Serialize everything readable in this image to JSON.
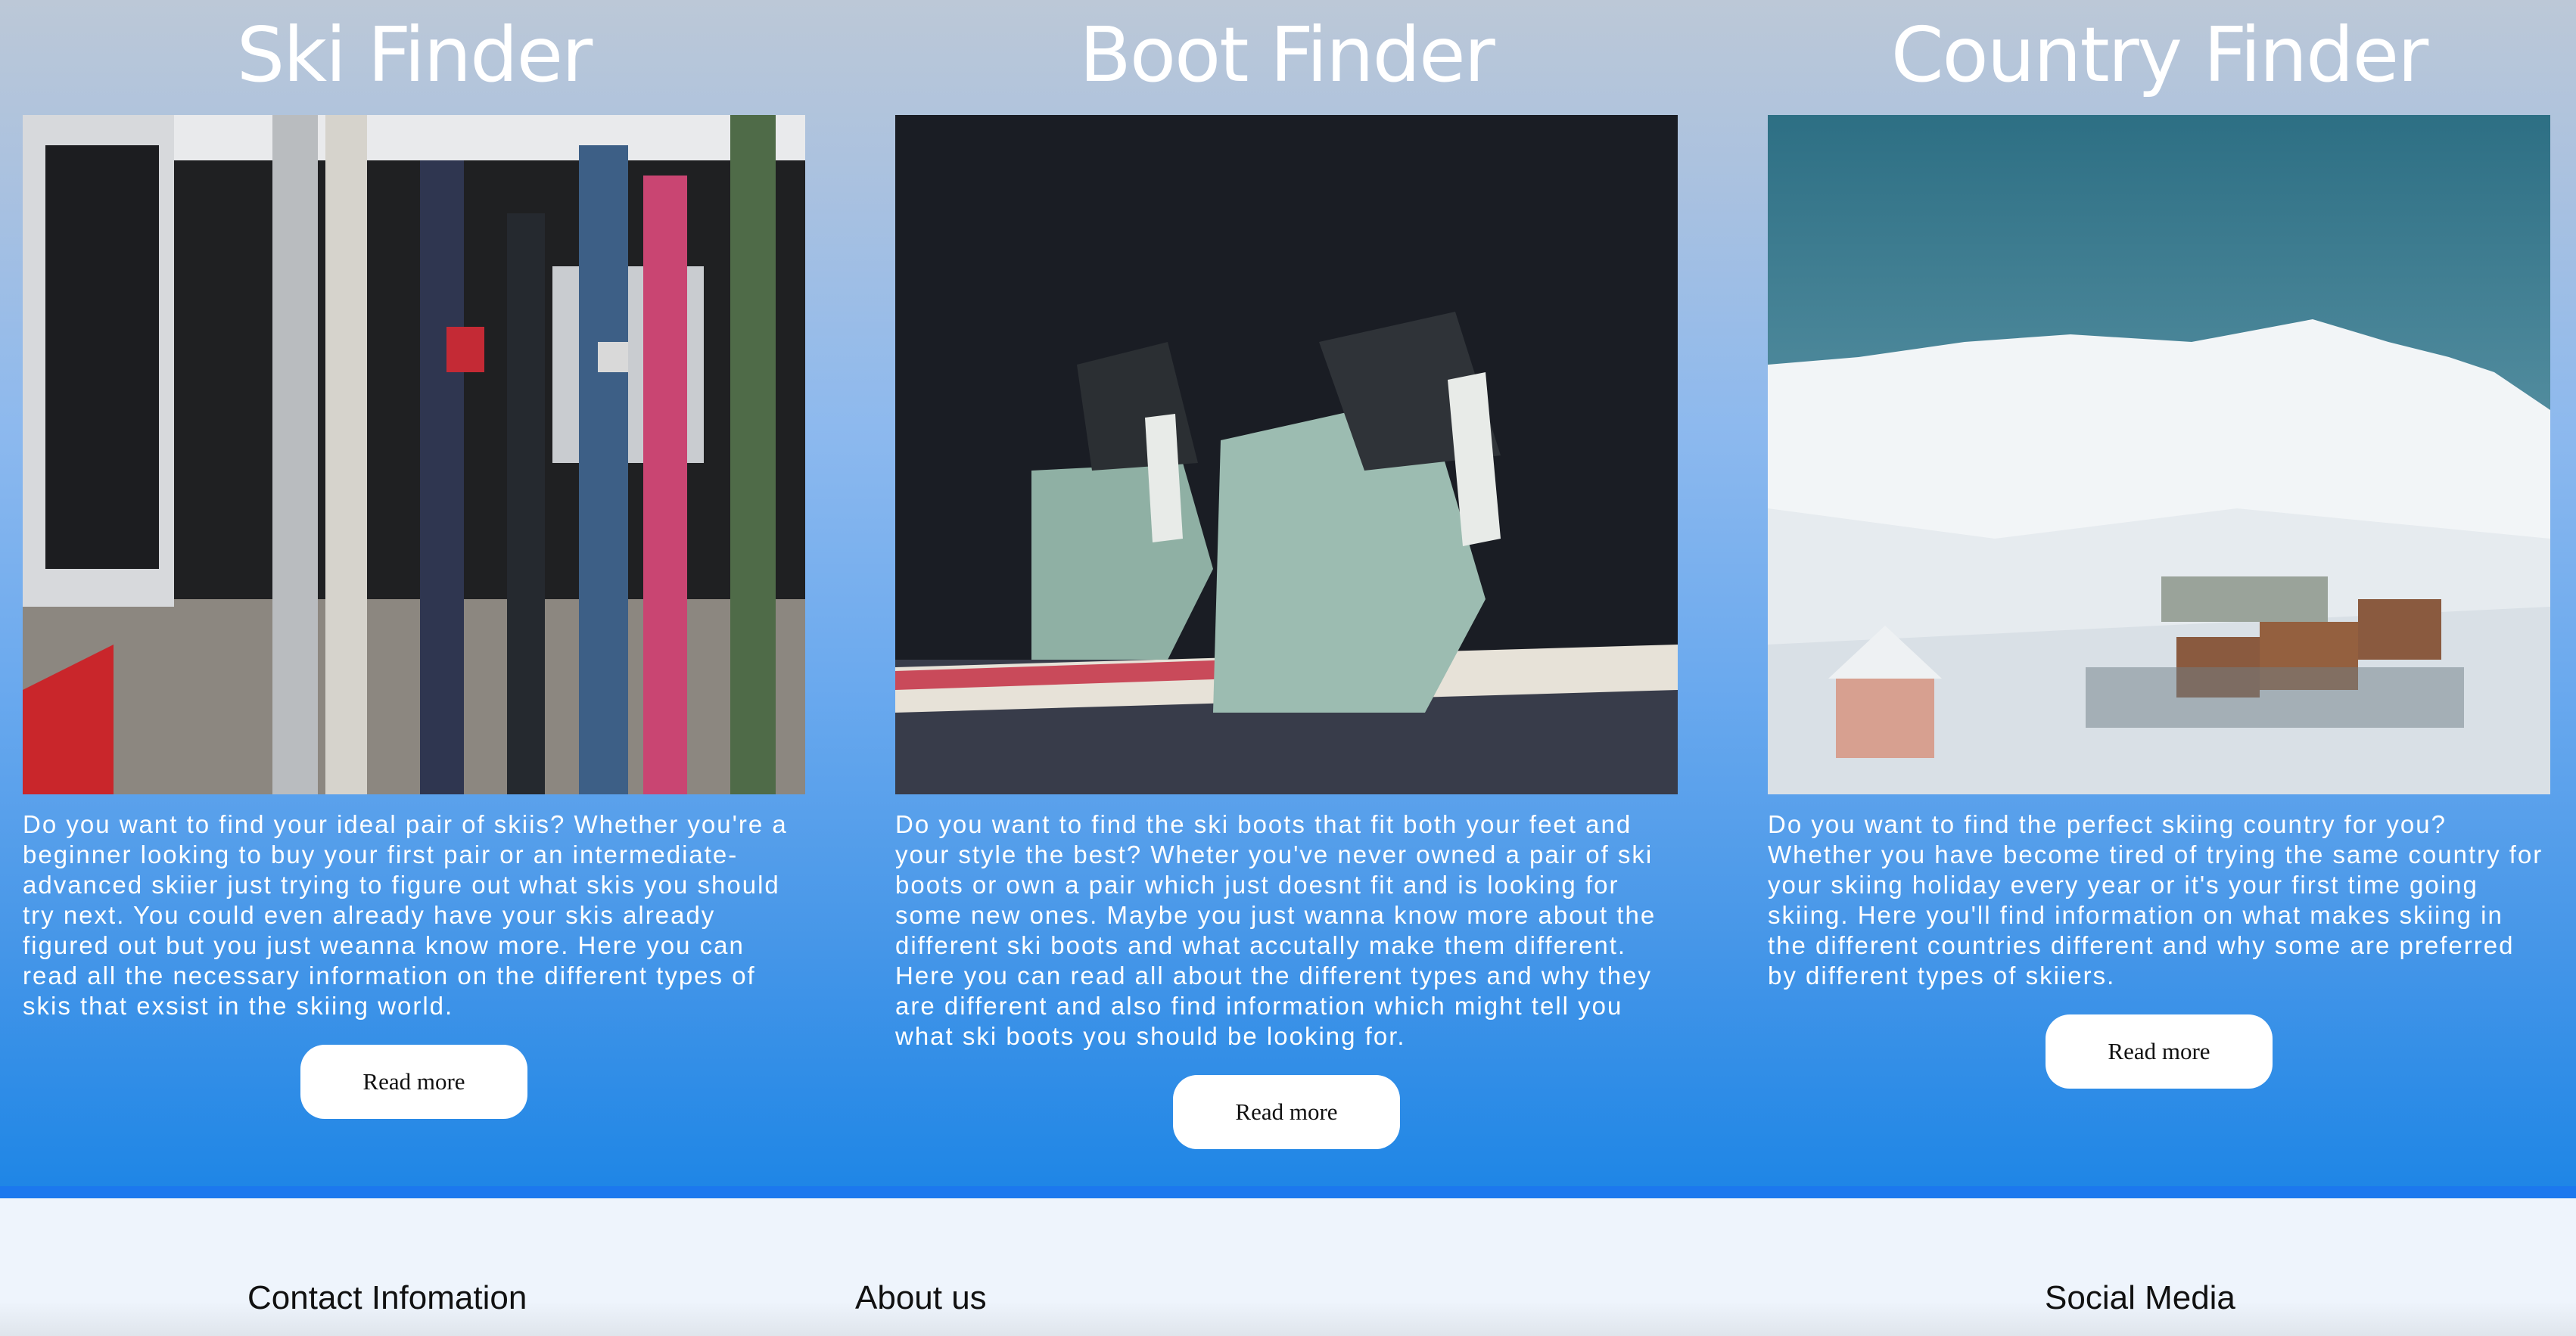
{
  "finders": [
    {
      "title": "Ski Finder",
      "description": "Do you want to find your ideal pair of skiis? Whether you're a beginner looking to buy your first pair or an intermediate-advanced skiier just trying to figure out what skis you should try next. You could even already have your skis already figured out but you just weanna know more. Here you can read all the necessary information on the different types of skis that exsist in the skiing world.",
      "button": "Read more",
      "image": "skis-leaning-on-van-photo"
    },
    {
      "title": "Boot Finder",
      "description": "Do you want to find the ski boots that fit both your feet and your style the best? Wheter you've never owned a pair of ski boots or own a pair which just doesnt fit and is looking for some new ones. Maybe you just wanna know more about the different ski boots and what accutally make them different. Here you can read all about the different types and why they are different and also find information which might tell you what ski boots you should be looking for.",
      "button": "Read more",
      "image": "ski-boots-photo"
    },
    {
      "title": "Country Finder",
      "description": "Do you want to find the perfect skiing country for you? Whether you have become tired of trying the same country for your skiing holiday every year or it's your first time going skiing. Here you'll find information on what makes skiing in the different countries different and why some are preferred by different types of skiiers.",
      "button": "Read more",
      "image": "snowy-mountain-resort-photo"
    }
  ],
  "footer": {
    "contact": "Contact Infomation",
    "about": "About us",
    "social": "Social Media"
  },
  "colors": {
    "hero_top": "#bcc8d7",
    "hero_bottom": "#1f86e6",
    "divider": "#1c78ee",
    "footer_bg": "#eef4fc",
    "button_bg": "#ffffff"
  }
}
